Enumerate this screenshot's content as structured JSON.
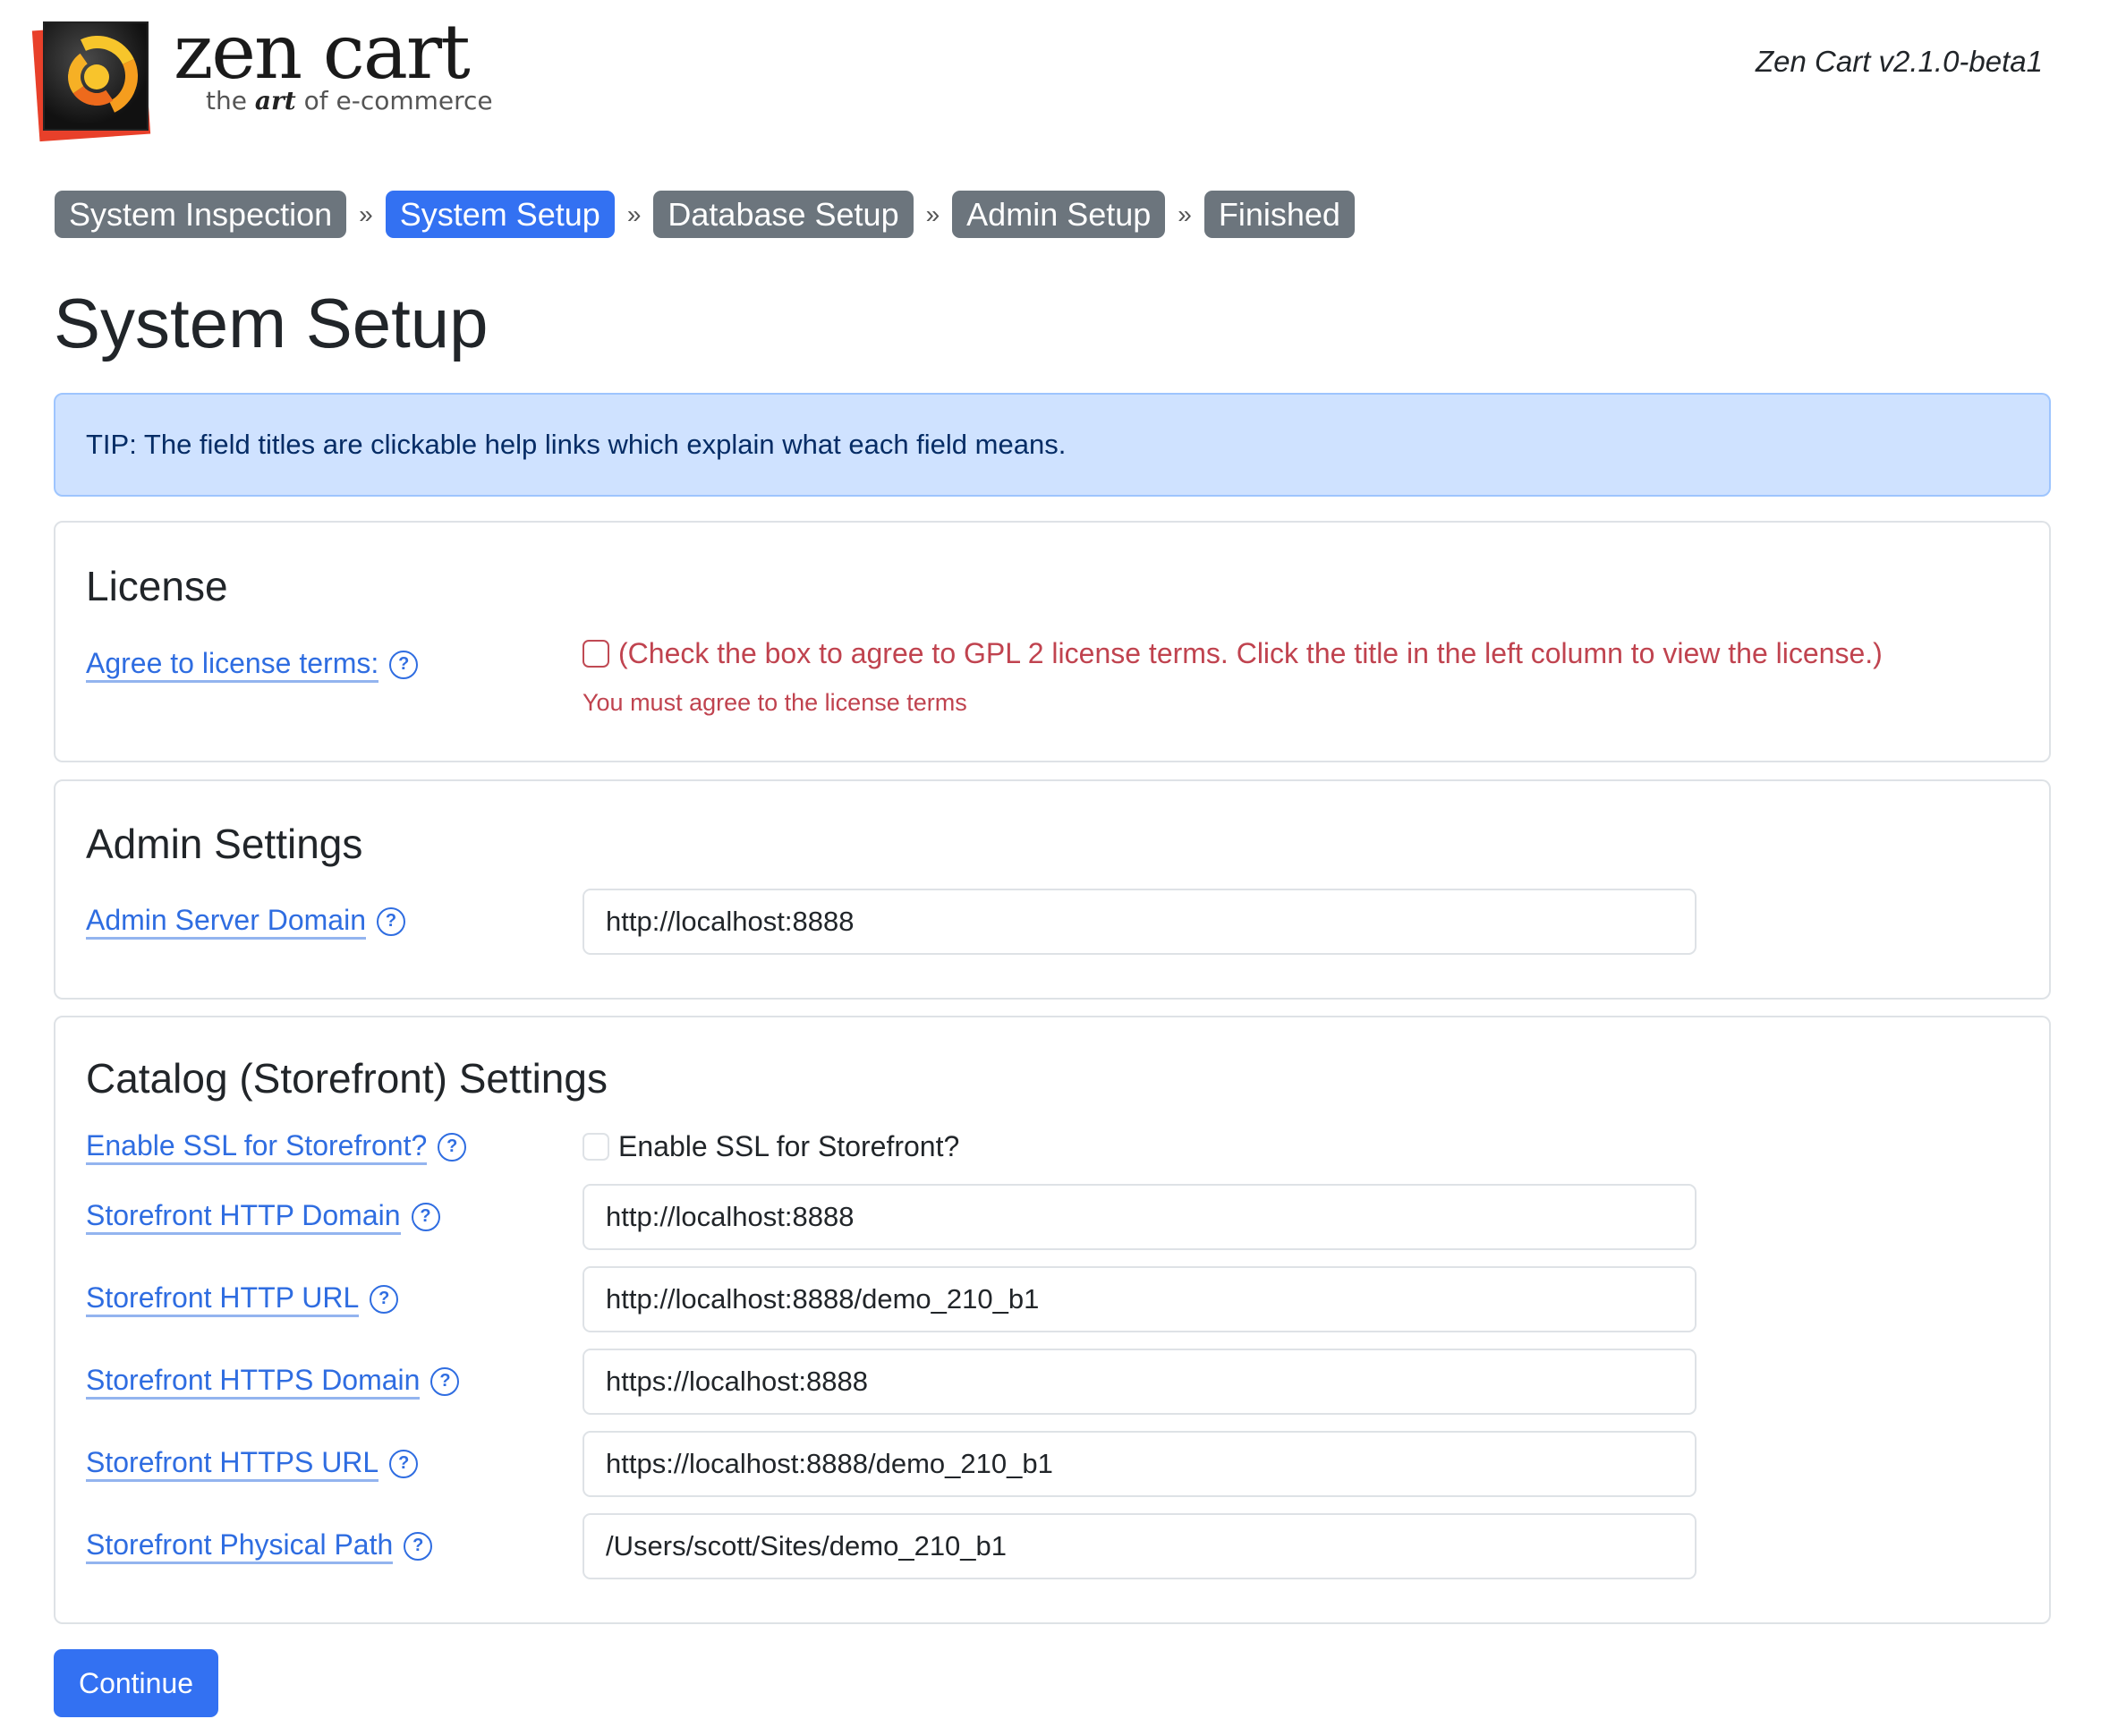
{
  "header": {
    "logo_name": "zen cart",
    "logo_tagline_pre": "the",
    "logo_tagline_em": "art",
    "logo_tagline_post": "of e-commerce",
    "version": "Zen Cart v2.1.0-beta1"
  },
  "steps": [
    {
      "label": "System Inspection",
      "active": false
    },
    {
      "label": "System Setup",
      "active": true
    },
    {
      "label": "Database Setup",
      "active": false
    },
    {
      "label": "Admin Setup",
      "active": false
    },
    {
      "label": "Finished",
      "active": false
    }
  ],
  "step_separator": "»",
  "page_title": "System Setup",
  "tip": "TIP: The field titles are clickable help links which explain what each field means.",
  "license": {
    "heading": "License",
    "label": "Agree to license terms:",
    "checkbox_checked": false,
    "checkbox_text": "(Check the box to agree to GPL 2 license terms. Click the title in the left column to view the license.)",
    "error": "You must agree to the license terms"
  },
  "admin": {
    "heading": "Admin Settings",
    "fields": [
      {
        "label": "Admin Server Domain",
        "value": "http://localhost:8888"
      }
    ]
  },
  "catalog": {
    "heading": "Catalog (Storefront) Settings",
    "ssl": {
      "label": "Enable SSL for Storefront?",
      "checkbox_text": "Enable SSL for Storefront?",
      "checked": false
    },
    "fields": [
      {
        "label": "Storefront HTTP Domain",
        "value": "http://localhost:8888"
      },
      {
        "label": "Storefront HTTP URL",
        "value": "http://localhost:8888/demo_210_b1"
      },
      {
        "label": "Storefront HTTPS Domain",
        "value": "https://localhost:8888"
      },
      {
        "label": "Storefront HTTPS URL",
        "value": "https://localhost:8888/demo_210_b1"
      },
      {
        "label": "Storefront Physical Path",
        "value": "/Users/scott/Sites/demo_210_b1"
      }
    ]
  },
  "help_icon_glyph": "?",
  "continue_label": "Continue",
  "colors": {
    "primary": "#3371f2",
    "step_inactive": "#6c757d",
    "link": "#2f6de1",
    "danger": "#c0434f",
    "tip_bg": "#cfe2ff"
  }
}
